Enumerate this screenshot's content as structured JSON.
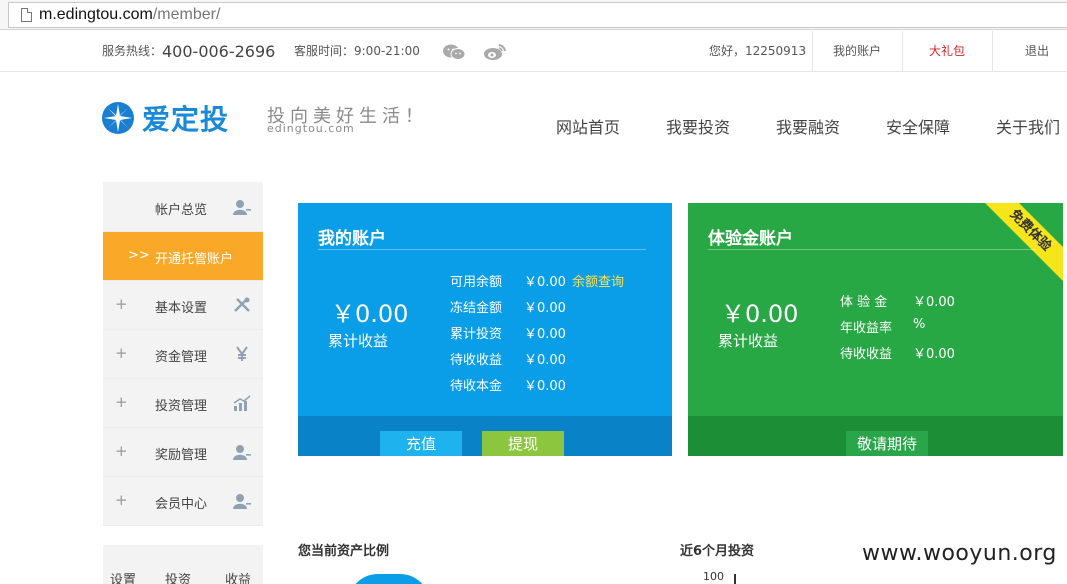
{
  "browser": {
    "url_host": "m.edingtou.com",
    "url_path": "/member/"
  },
  "topbar": {
    "hotline_label": "服务热线：",
    "hotline_number": "400-006-2696",
    "service_hours": "客服时间：9:00-21:00",
    "greeting": "您好，12250913",
    "my_account": "我的账户",
    "gift": "大礼包",
    "logout": "退出"
  },
  "brand": {
    "name": "爱定投",
    "slogan": "投向美好生活！",
    "domain": "edingtou.com"
  },
  "nav": [
    "网站首页",
    "我要投资",
    "我要融资",
    "安全保障",
    "关于我们"
  ],
  "sidebar": {
    "items": [
      {
        "label": "帐户总览",
        "icon": "user-icon"
      },
      {
        "label": "开通托管账户",
        "prefix": ">>",
        "active": true
      },
      {
        "label": "基本设置",
        "icon": "tools-icon"
      },
      {
        "label": "资金管理",
        "icon": "yen-icon"
      },
      {
        "label": "投资管理",
        "icon": "chart-icon"
      },
      {
        "label": "奖励管理",
        "icon": "user-icon"
      },
      {
        "label": "会员中心",
        "icon": "user-icon"
      }
    ],
    "plus": "+",
    "bottom_tabs": [
      "设置",
      "投资",
      "收益"
    ]
  },
  "account_card": {
    "title": "我的账户",
    "total": "￥0.00",
    "total_label": "累计收益",
    "rows": [
      {
        "label": "可用余额",
        "value": "￥0.00"
      },
      {
        "label": "冻结金额",
        "value": "￥0.00"
      },
      {
        "label": "累计投资",
        "value": "￥0.00"
      },
      {
        "label": "待收收益",
        "value": "￥0.00"
      },
      {
        "label": "待收本金",
        "value": "￥0.00"
      }
    ],
    "balance_query": "余额查询",
    "recharge": "充值",
    "withdraw": "提现"
  },
  "trial_card": {
    "title": "体验金账户",
    "ribbon": "免费体验",
    "total": "￥0.00",
    "total_label": "累计收益",
    "rows": [
      {
        "label": "体 验 金",
        "value": "￥0.00"
      },
      {
        "label": "年收益率",
        "value": "%"
      },
      {
        "label": "待收收益",
        "value": "￥0.00"
      }
    ],
    "wait": "敬请期待"
  },
  "bottom": {
    "asset_ratio_title": "您当前资产比例",
    "invest_title": "近6个月投资",
    "axis_top": "100"
  },
  "watermark": "www.wooyun.org",
  "colors": {
    "blue": "#0b9ee8",
    "green": "#28a745",
    "orange": "#f9a828",
    "red": "#d0262c"
  }
}
